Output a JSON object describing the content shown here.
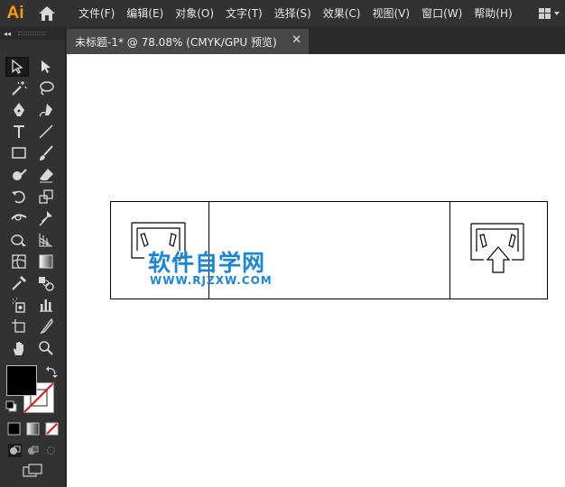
{
  "app": {
    "logo": "Ai"
  },
  "menu": [
    "文件(F)",
    "编辑(E)",
    "对象(O)",
    "文字(T)",
    "选择(S)",
    "效果(C)",
    "视图(V)",
    "窗口(W)",
    "帮助(H)"
  ],
  "toolbar": {
    "collapse": "◂◂"
  },
  "document_tab": {
    "title": "未标题-1* @ 78.08% (CMYK/GPU 预览)",
    "close": "✕"
  },
  "watermark": {
    "title": "软件自学网",
    "url": "WWW.RJZXW.COM"
  },
  "colors": {
    "accent": "#ff9a00",
    "watermark": "#1a86d8",
    "panel": "#323232",
    "canvas": "#ffffff"
  }
}
